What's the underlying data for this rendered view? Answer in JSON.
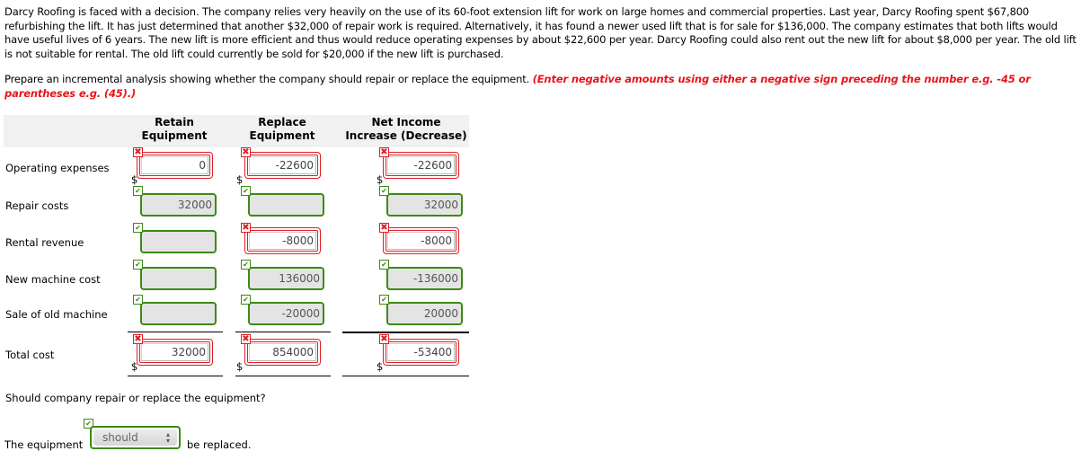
{
  "problem": {
    "text": "Darcy Roofing is faced with a decision. The company relies very heavily on the use of its 60-foot extension lift for work on large homes and commercial properties. Last year, Darcy Roofing spent $67,800 refurbishing the lift. It has just determined that another $32,000 of repair work is required. Alternatively, it has found a newer used lift that is for sale for $136,000. The company estimates that both lifts would have useful lives of 6 years. The new lift is more efficient and thus would reduce operating expenses by about $22,600 per year. Darcy Roofing could also rent out the new lift for about $8,000 per year. The old lift is not suitable for rental. The old lift could currently be sold for $20,000 if the new lift is purchased."
  },
  "instruction": {
    "text": "Prepare an incremental analysis showing whether the company should repair or replace the equipment. ",
    "hint": "(Enter negative amounts using either a negative sign preceding the number e.g. -45 or parentheses e.g. (45).)"
  },
  "table": {
    "columns": [
      {
        "line1": "Retain",
        "line2": "Equipment"
      },
      {
        "line1": "Replace",
        "line2": "Equipment"
      },
      {
        "line1": "Net Income",
        "line2": "Increase (Decrease)"
      }
    ],
    "currency_symbol": "$",
    "rows": [
      {
        "label": "Operating expenses",
        "cells": [
          {
            "value": "0",
            "status": "incorrect"
          },
          {
            "value": "-22600",
            "status": "incorrect"
          },
          {
            "value": "-22600",
            "status": "incorrect"
          }
        ]
      },
      {
        "label": "Repair costs",
        "cells": [
          {
            "value": "32000",
            "status": "correct"
          },
          {
            "value": "",
            "status": "correct"
          },
          {
            "value": "32000",
            "status": "correct"
          }
        ]
      },
      {
        "label": "Rental revenue",
        "cells": [
          {
            "value": "",
            "status": "correct"
          },
          {
            "value": "-8000",
            "status": "incorrect"
          },
          {
            "value": "-8000",
            "status": "incorrect"
          }
        ]
      },
      {
        "label": "New machine cost",
        "cells": [
          {
            "value": "",
            "status": "correct"
          },
          {
            "value": "136000",
            "status": "correct"
          },
          {
            "value": "-136000",
            "status": "correct"
          }
        ]
      },
      {
        "label": "Sale of old machine",
        "cells": [
          {
            "value": "",
            "status": "correct"
          },
          {
            "value": "-20000",
            "status": "correct"
          },
          {
            "value": "20000",
            "status": "correct"
          }
        ]
      },
      {
        "label": "Total cost",
        "cells": [
          {
            "value": "32000",
            "status": "incorrect"
          },
          {
            "value": "854000",
            "status": "incorrect"
          },
          {
            "value": "-53400",
            "status": "incorrect"
          }
        ]
      }
    ]
  },
  "question": {
    "text": "Should company repair or replace the equipment?",
    "answer_prefix": "The equipment",
    "answer_selected": "should",
    "answer_status": "correct",
    "answer_suffix": "be replaced."
  },
  "icons": {
    "incorrect": "✖",
    "correct": "✔",
    "select_arrows": "▲▼"
  }
}
